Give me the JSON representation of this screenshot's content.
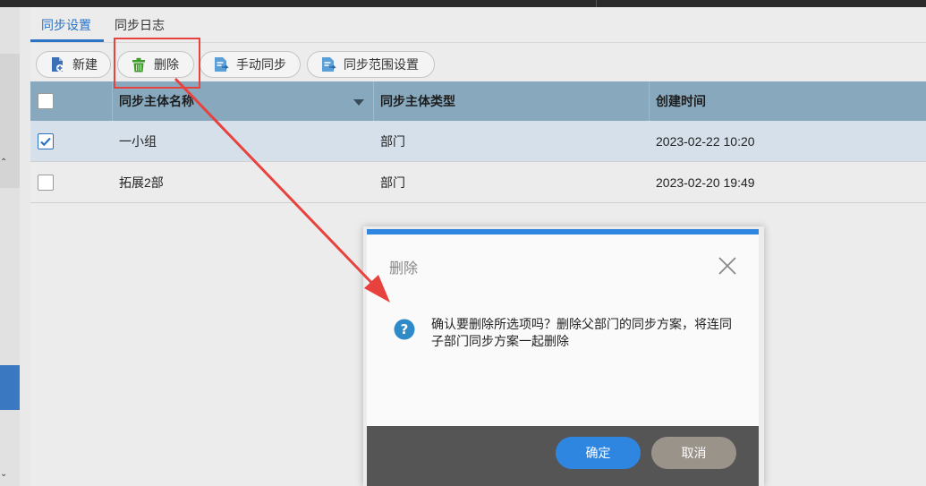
{
  "tabs": [
    {
      "label": "同步设置",
      "active": true
    },
    {
      "label": "同步日志",
      "active": false
    }
  ],
  "toolbar": {
    "new_label": "新建",
    "delete_label": "删除",
    "manual_sync_label": "手动同步",
    "scope_settings_label": "同步范围设置"
  },
  "grid": {
    "columns": [
      "同步主体名称",
      "同步主体类型",
      "创建时间"
    ],
    "rows": [
      {
        "checked": true,
        "name": "一小组",
        "type": "部门",
        "created": "2023-02-22 10:20"
      },
      {
        "checked": false,
        "name": "拓展2部",
        "type": "部门",
        "created": "2023-02-20 19:49"
      }
    ]
  },
  "dialog": {
    "title": "删除",
    "message": "确认要删除所选项吗？删除父部门的同步方案，将连同子部门同步方案一起删除",
    "ok_label": "确定",
    "cancel_label": "取消"
  },
  "colors": {
    "accent": "#2a73c5",
    "header_bg": "#87a8bd",
    "selected_row": "#d5e0ea",
    "annotation_red": "#e8423e",
    "ok_button": "#2f86e0",
    "cancel_button": "#9a938a"
  },
  "icons": {
    "new": "new-document-icon",
    "delete": "trash-icon",
    "manual_sync": "sync-document-icon",
    "scope": "scope-document-icon",
    "question": "question-icon",
    "close": "close-icon"
  }
}
